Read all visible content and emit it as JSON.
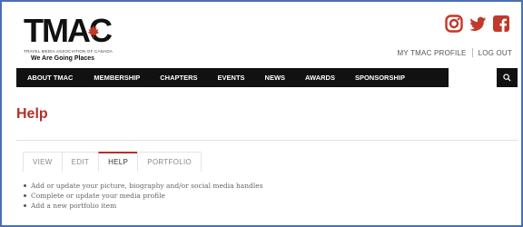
{
  "brand": {
    "logo_text": "TMAC",
    "subtitle": "TRAVEL MEDIA ASSOCIATION OF CANADA",
    "tagline": "We Are Going Places"
  },
  "social": {
    "icons": [
      "instagram-icon",
      "twitter-icon",
      "facebook-icon"
    ],
    "color": "#c0392b"
  },
  "header_links": {
    "profile": "MY TMAC PROFILE",
    "logout": "LOG OUT"
  },
  "nav": {
    "items": [
      "ABOUT TMAC",
      "MEMBERSHIP",
      "CHAPTERS",
      "EVENTS",
      "NEWS",
      "AWARDS",
      "SPONSORSHIP"
    ],
    "search_icon": "search-icon"
  },
  "page": {
    "title": "Help",
    "accent_color": "#b3312a"
  },
  "tabs": {
    "items": [
      "VIEW",
      "EDIT",
      "HELP",
      "PORTFOLIO"
    ],
    "active": "HELP"
  },
  "help_items": [
    "Add or update your picture, biography and/or social media handles",
    "Complete or update your media profile",
    "Add a new portfolio item"
  ]
}
